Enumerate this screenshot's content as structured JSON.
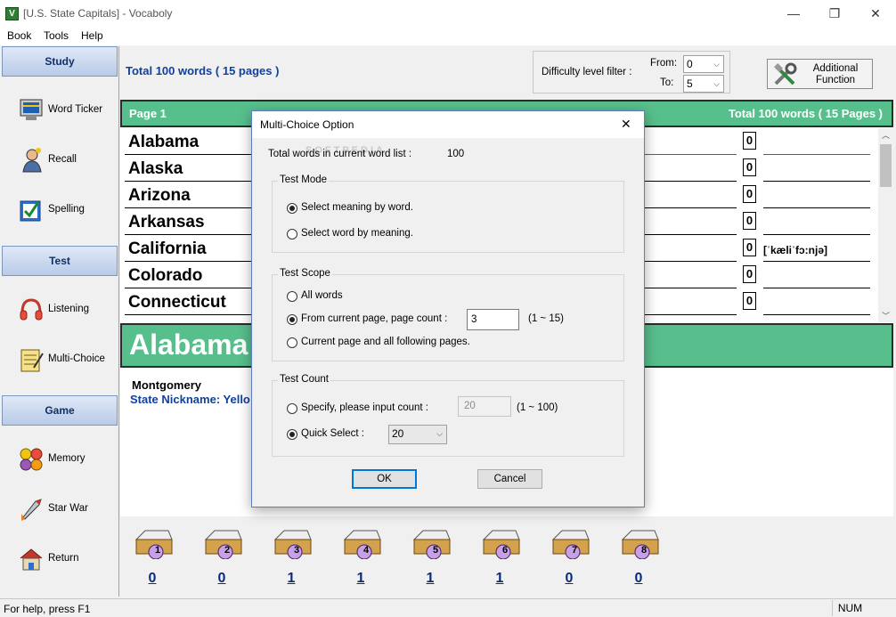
{
  "window": {
    "title": "[U.S. State Capitals] - Vocaboly",
    "buttons": {
      "minimize": "—",
      "maximize": "❐",
      "close": "✕"
    }
  },
  "menu": [
    "Book",
    "Tools",
    "Help"
  ],
  "sidebar": {
    "sections": [
      {
        "title": "Study",
        "items": [
          {
            "label": "Word Ticker",
            "icon": "monitor-icon"
          },
          {
            "label": "Recall",
            "icon": "thinker-icon"
          },
          {
            "label": "Spelling",
            "icon": "spelling-check-icon"
          }
        ]
      },
      {
        "title": "Test",
        "items": [
          {
            "label": "Listening",
            "icon": "headphones-icon"
          },
          {
            "label": "Multi-Choice",
            "icon": "notepad-icon"
          }
        ]
      },
      {
        "title": "Game",
        "items": [
          {
            "label": "Memory",
            "icon": "faces-icon"
          },
          {
            "label": "Star War",
            "icon": "rocket-icon"
          },
          {
            "label": "Return",
            "icon": "house-icon"
          }
        ]
      }
    ]
  },
  "topbar": {
    "total": "Total 100 words ( 15 pages )",
    "difficulty_label": "Difficulty level filter :",
    "from_label": "From:",
    "from_value": "0",
    "to_label": "To:",
    "to_value": "5",
    "additional_line1": "Additional",
    "additional_line2": "Function"
  },
  "wordlist": {
    "page_label": "Page 1",
    "total_label": "Total 100 words ( 15 Pages )",
    "words": [
      {
        "word": "Alabama",
        "count": "0",
        "phonetic": ""
      },
      {
        "word": "Alaska",
        "count": "0",
        "phonetic": ""
      },
      {
        "word": "Arizona",
        "count": "0",
        "phonetic": ""
      },
      {
        "word": "Arkansas",
        "count": "0",
        "phonetic": ""
      },
      {
        "word": "California",
        "count": "0",
        "phonetic": "[ˈkæliˈfɔ:njə]"
      },
      {
        "word": "Colorado",
        "count": "0",
        "phonetic": ""
      },
      {
        "word": "Connecticut",
        "count": "0",
        "phonetic": ""
      }
    ]
  },
  "current": {
    "word": "Alabama",
    "meaning": "Montgomery",
    "extra": "State Nickname: Yello"
  },
  "cards": [
    {
      "n": "1",
      "count": "0"
    },
    {
      "n": "2",
      "count": "0"
    },
    {
      "n": "3",
      "count": "1"
    },
    {
      "n": "4",
      "count": "1"
    },
    {
      "n": "5",
      "count": "1"
    },
    {
      "n": "6",
      "count": "1"
    },
    {
      "n": "7",
      "count": "0"
    },
    {
      "n": "8",
      "count": "0"
    }
  ],
  "status": {
    "help": "For help, press F1",
    "num": "NUM"
  },
  "dialog": {
    "title": "Multi-Choice Option",
    "close": "✕",
    "total_label": "Total words in current word list :",
    "total_value": "100",
    "mode": {
      "title": "Test Mode",
      "opt1": "Select meaning by word.",
      "opt2": "Select word by meaning."
    },
    "scope": {
      "title": "Test Scope",
      "opt1": "All words",
      "opt2": "From current page, page count :",
      "page_count": "3",
      "range": "(1 ~ 15)",
      "opt3": "Current page and all following pages."
    },
    "count": {
      "title": "Test Count",
      "opt1": "Specify, please input count :",
      "specify_value": "20",
      "range": "(1 ~ 100)",
      "opt2": "Quick Select :",
      "quick_value": "20"
    },
    "ok": "OK",
    "cancel": "Cancel"
  },
  "watermark": "SOFTPEDIA"
}
